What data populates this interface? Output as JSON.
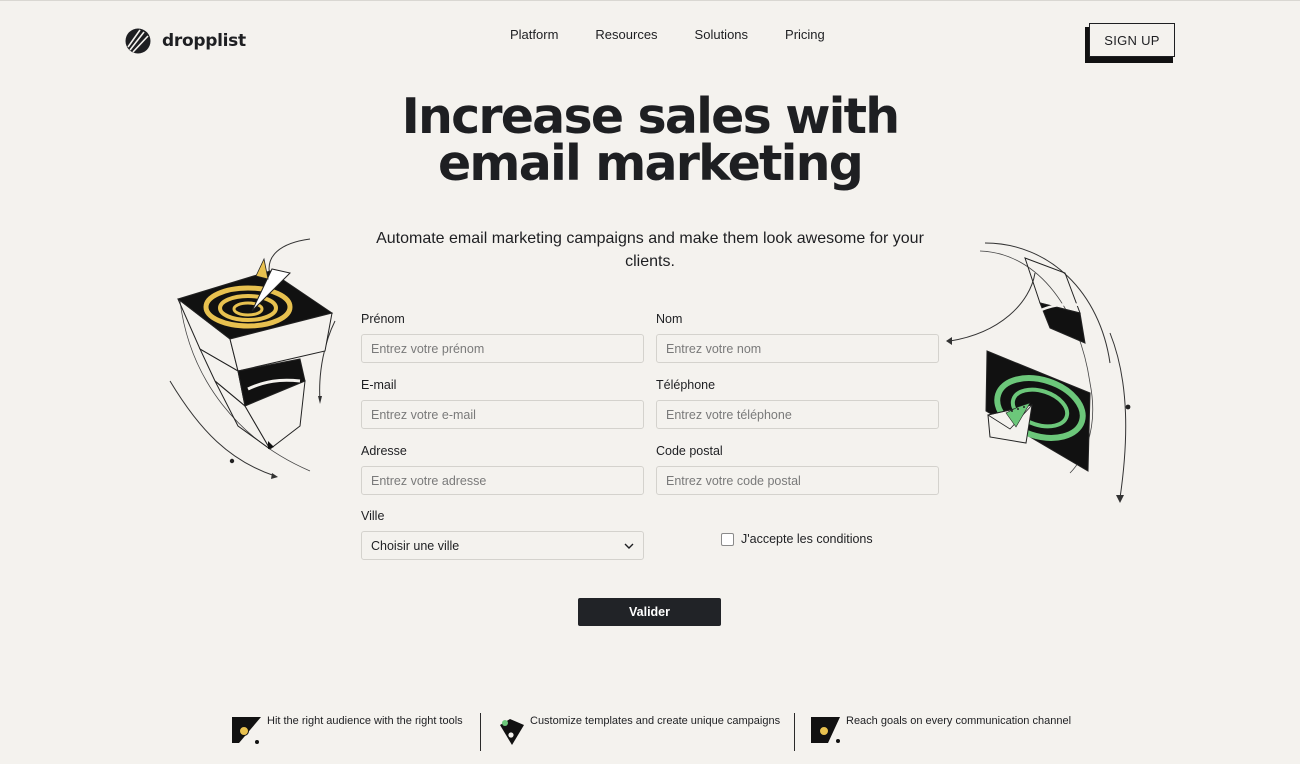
{
  "brand": {
    "name": "dropplist"
  },
  "nav": {
    "items": [
      "Platform",
      "Resources",
      "Solutions",
      "Pricing"
    ],
    "signup_label": "SIGN UP"
  },
  "hero": {
    "headline_line1": "Increase sales with",
    "headline_line2": "email marketing",
    "subtitle": "Automate email marketing campaigns and make them look awesome for your clients."
  },
  "form": {
    "first_name": {
      "label": "Prénom",
      "placeholder": "Entrez votre prénom"
    },
    "last_name": {
      "label": "Nom",
      "placeholder": "Entrez votre nom"
    },
    "email": {
      "label": "E-mail",
      "placeholder": "Entrez votre e-mail"
    },
    "phone": {
      "label": "Téléphone",
      "placeholder": "Entrez votre téléphone"
    },
    "address": {
      "label": "Adresse",
      "placeholder": "Entrez votre adresse"
    },
    "postal_code": {
      "label": "Code postal",
      "placeholder": "Entrez votre code postal"
    },
    "city": {
      "label": "Ville",
      "selected": "Choisir une ville"
    },
    "terms_label": "J'accepte les conditions",
    "submit_label": "Valider"
  },
  "features": [
    {
      "text": "Hit the right audience with the right tools",
      "icon": "audience-icon"
    },
    {
      "text": "Customize templates and create unique campaigns",
      "icon": "template-icon"
    },
    {
      "text": "Reach goals on every communication channel",
      "icon": "channel-icon"
    }
  ],
  "colors": {
    "background": "#f4f2ee",
    "text": "#1e1f22",
    "button": "#212327",
    "accent_yellow": "#e8c14f",
    "accent_green": "#6cc77a"
  }
}
